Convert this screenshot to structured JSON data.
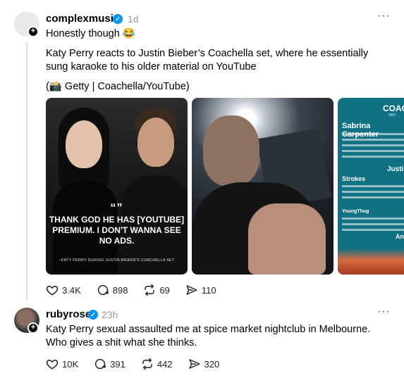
{
  "post1": {
    "username": "complexmusic",
    "time": "1d",
    "verified_mark": "✓",
    "more": "···",
    "caption": "Honestly though 😂",
    "body": "Katy Perry reacts to Justin Bieber’s Coachella set, where he essentially sung karaoke to his older material on YouTube",
    "photo_credit": "(📸 Getty | Coachella/YouTube)",
    "image1": {
      "quote_mark": "“”",
      "quote": "THANK GOD HE HAS [YOUTUBE] PREMIUM. I DON'T WANNA SEE NO ADS.",
      "credit": "–KATY PERRY DURING JUSTIN BIEBER'S COACHELLA SET"
    },
    "image3": {
      "title": "COAC",
      "subtitle": "INDI",
      "headliner1": "Sabrina Carpenter",
      "headliner2": "Justi",
      "strokes": "Strokes",
      "youngthug": "YoungThug",
      "anyma": "An"
    },
    "actions": {
      "likes": "3.4K",
      "comments": "898",
      "reposts": "69",
      "shares": "110"
    }
  },
  "post2": {
    "username": "rubyrose",
    "time": "23h",
    "verified_mark": "✓",
    "more": "···",
    "body": "Katy Perry sexual assaulted me at spice market nightclub in Melbourne. Who gives a shit what she thinks.",
    "actions": {
      "likes": "10K",
      "comments": "391",
      "reposts": "442",
      "shares": "320"
    }
  },
  "icons": [
    "heart-icon",
    "comment-icon",
    "repost-icon",
    "share-icon",
    "verified-icon",
    "more-icon",
    "follow-plus-icon"
  ]
}
